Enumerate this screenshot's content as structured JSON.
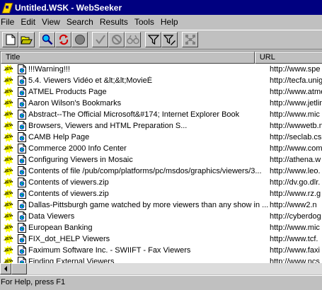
{
  "window": {
    "title": "Untitled.WSK - WebSeeker"
  },
  "menu": [
    "File",
    "Edit",
    "View",
    "Search",
    "Results",
    "Tools",
    "Help"
  ],
  "toolbar": {
    "icons": [
      "new-document-icon",
      "open-folder-icon",
      "search-icon",
      "refresh-icon",
      "stop-icon",
      "check-icon",
      "cancel-icon",
      "binoculars-icon",
      "filter-icon",
      "filter-edit-icon",
      "network-icon"
    ]
  },
  "list": {
    "columns": {
      "title": "Title",
      "url": "URL"
    },
    "rows": [
      {
        "title": "!!!Warning!!!",
        "url": "http://www.spe"
      },
      {
        "title": "5.4. Viewers Vidéo et &lt;&lt;MovieÈ",
        "url": "http://tecfa.unig"
      },
      {
        "title": "ATMEL Products Page",
        "url": "http://www.atme"
      },
      {
        "title": "Aaron Wilson's Bookmarks",
        "url": "http://www.jetlin"
      },
      {
        "title": "Abstract--The Official Microsoft&#174; Internet Explorer Book",
        "url": "http://www.mic"
      },
      {
        "title": "Browsers, Viewers and HTML Preparation S...",
        "url": "http://wwwetb.n"
      },
      {
        "title": "CAMB Help Page",
        "url": "http://seclab.cs"
      },
      {
        "title": "Commerce 2000 Info Center",
        "url": "http://www.com"
      },
      {
        "title": "Configuring Viewers in Mosaic",
        "url": "http://athena.w"
      },
      {
        "title": "Contents of file /pub/comp/platforms/pc/msdos/graphics/viewers/3...",
        "url": "http://www.leo."
      },
      {
        "title": "Contents of viewers.zip",
        "url": "http://dv.go.dlr."
      },
      {
        "title": "Contents of viewers.zip",
        "url": "http://www.rz.g"
      },
      {
        "title": "Dallas-Pittsburgh game watched by more viewers than any show in ...",
        "url": "http://www2.n"
      },
      {
        "title": "Data Viewers",
        "url": "http://cyberdog"
      },
      {
        "title": "European Banking",
        "url": "http://www.mic"
      },
      {
        "title": "FIX_dot_HELP Viewers",
        "url": "http://www.tcf."
      },
      {
        "title": "Faximum Software Inc. - SWIIFT - Fax Viewers",
        "url": "http://www.faxi"
      },
      {
        "title": "Finding External Viewers",
        "url": "http://www.ncs"
      }
    ],
    "new_badge": "NEW"
  },
  "status": {
    "text": "For Help, press F1"
  }
}
